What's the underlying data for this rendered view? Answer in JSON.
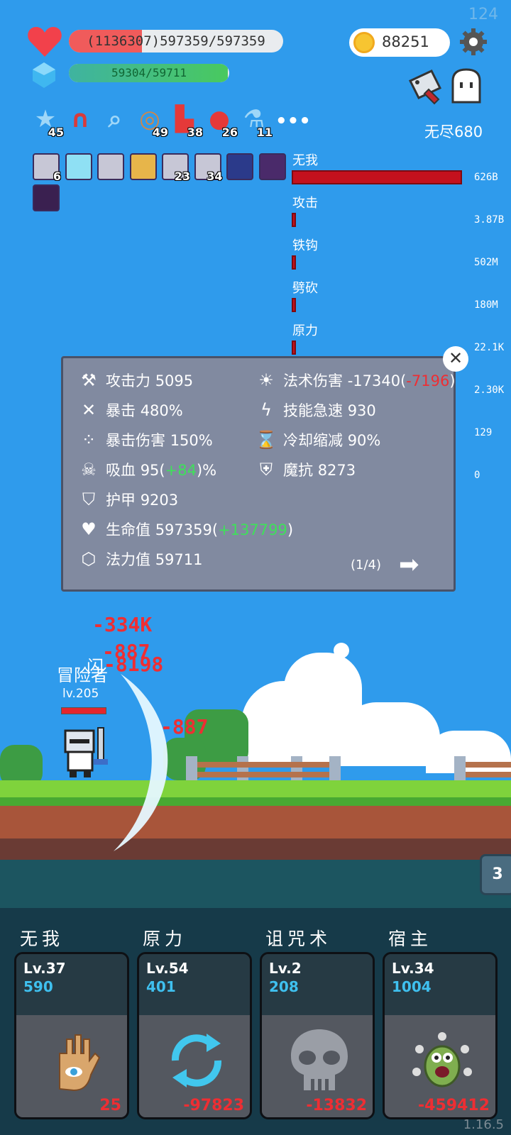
{
  "hud": {
    "fps": "124",
    "hp_text": "(1136307)597359/597359",
    "hp_fraction": 0.34,
    "mana_text": "59304/59711",
    "mana_fraction": 0.993,
    "gold": "88251",
    "mode_label": "无尽680"
  },
  "items": [
    {
      "icon": "star-card-icon",
      "count": "45"
    },
    {
      "icon": "magnet-icon",
      "count": ""
    },
    {
      "icon": "magnifier-icon",
      "count": ""
    },
    {
      "icon": "shield-round-icon",
      "count": "49"
    },
    {
      "icon": "boot-icon",
      "count": "38"
    },
    {
      "icon": "apple-icon",
      "count": "26"
    },
    {
      "icon": "potion-icon",
      "count": "11"
    }
  ],
  "skills_row": [
    {
      "icon": "sword-skill-icon",
      "count": "6"
    },
    {
      "icon": "light-skill-icon",
      "count": ""
    },
    {
      "icon": "sword-skill-icon",
      "count": ""
    },
    {
      "icon": "shield-skill-icon",
      "count": ""
    },
    {
      "icon": "sword-skill-icon",
      "count": "23"
    },
    {
      "icon": "sword-skill-icon",
      "count": "34"
    },
    {
      "icon": "wing-skill-icon",
      "count": ""
    },
    {
      "icon": "demon-skill-icon",
      "count": ""
    },
    {
      "icon": "dark-skill-icon",
      "count": ""
    }
  ],
  "damage_stats": [
    {
      "label": "无我",
      "value": "626B",
      "fraction": 1.0
    },
    {
      "label": "攻击",
      "value": "3.87B",
      "fraction": 0.006
    },
    {
      "label": "铁钩",
      "value": "502M",
      "fraction": 0.001
    },
    {
      "label": "劈砍",
      "value": "180M",
      "fraction": 0.0003
    },
    {
      "label": "原力",
      "value": "22.1K",
      "fraction": 0.0
    },
    {
      "label": "",
      "value": "2.30K",
      "fraction": 0.0
    },
    {
      "label": "",
      "value": "129",
      "fraction": 0.0
    },
    {
      "label": "",
      "value": "0",
      "fraction": 0.0
    }
  ],
  "stats_panel": {
    "attack": {
      "label": "攻击力",
      "value": "5095"
    },
    "crit": {
      "label": "暴击",
      "value": "480%"
    },
    "crit_damage": {
      "label": "暴击伤害",
      "value": "150%"
    },
    "lifesteal": {
      "label": "吸血",
      "value": "95",
      "paren_open": "(",
      "bonus": "+84",
      "paren_close": ")%"
    },
    "armor": {
      "label": "护甲",
      "value": "9203"
    },
    "hp": {
      "label": "生命值",
      "value": "597359",
      "paren_open": "(",
      "bonus": "+137799",
      "paren_close": ")"
    },
    "mana": {
      "label": "法力值",
      "value": "59711"
    },
    "spell_damage": {
      "label": "法术伤害",
      "value": "-17340",
      "paren_open": "(",
      "bonus": "-7196",
      "paren_close": ")"
    },
    "haste": {
      "label": "技能急速",
      "value": "930"
    },
    "cooldown": {
      "label": "冷却缩减",
      "value": "90%"
    },
    "magic_resist": {
      "label": "魔抗",
      "value": "8273"
    },
    "page": "(1/4)"
  },
  "battle": {
    "damage_numbers": [
      "-334K",
      "-887",
      "-8198",
      "-887"
    ],
    "dodge_text": "闪",
    "player_name": "冒险者",
    "player_level": "lv.205",
    "wave": "3"
  },
  "skill_cards": [
    {
      "title": "无我",
      "level": "Lv.37",
      "mana": "590",
      "cost": "25",
      "icon": "eye-hand-icon"
    },
    {
      "title": "原力",
      "level": "Lv.54",
      "mana": "401",
      "cost": "-97823",
      "icon": "cycle-arrows-icon"
    },
    {
      "title": "诅咒术",
      "level": "Lv.2",
      "mana": "208",
      "cost": "-13832",
      "icon": "skull-icon"
    },
    {
      "title": "宿主",
      "level": "Lv.34",
      "mana": "1004",
      "cost": "-459412",
      "icon": "eye-monster-icon"
    }
  ],
  "version": "1.16.5",
  "colors": {
    "sky": "#2f9bec",
    "hp": "#f05b5b",
    "damage_red": "#ee2e33",
    "heal_green": "#3fe05a",
    "mana_blue": "#3fc0ef"
  }
}
